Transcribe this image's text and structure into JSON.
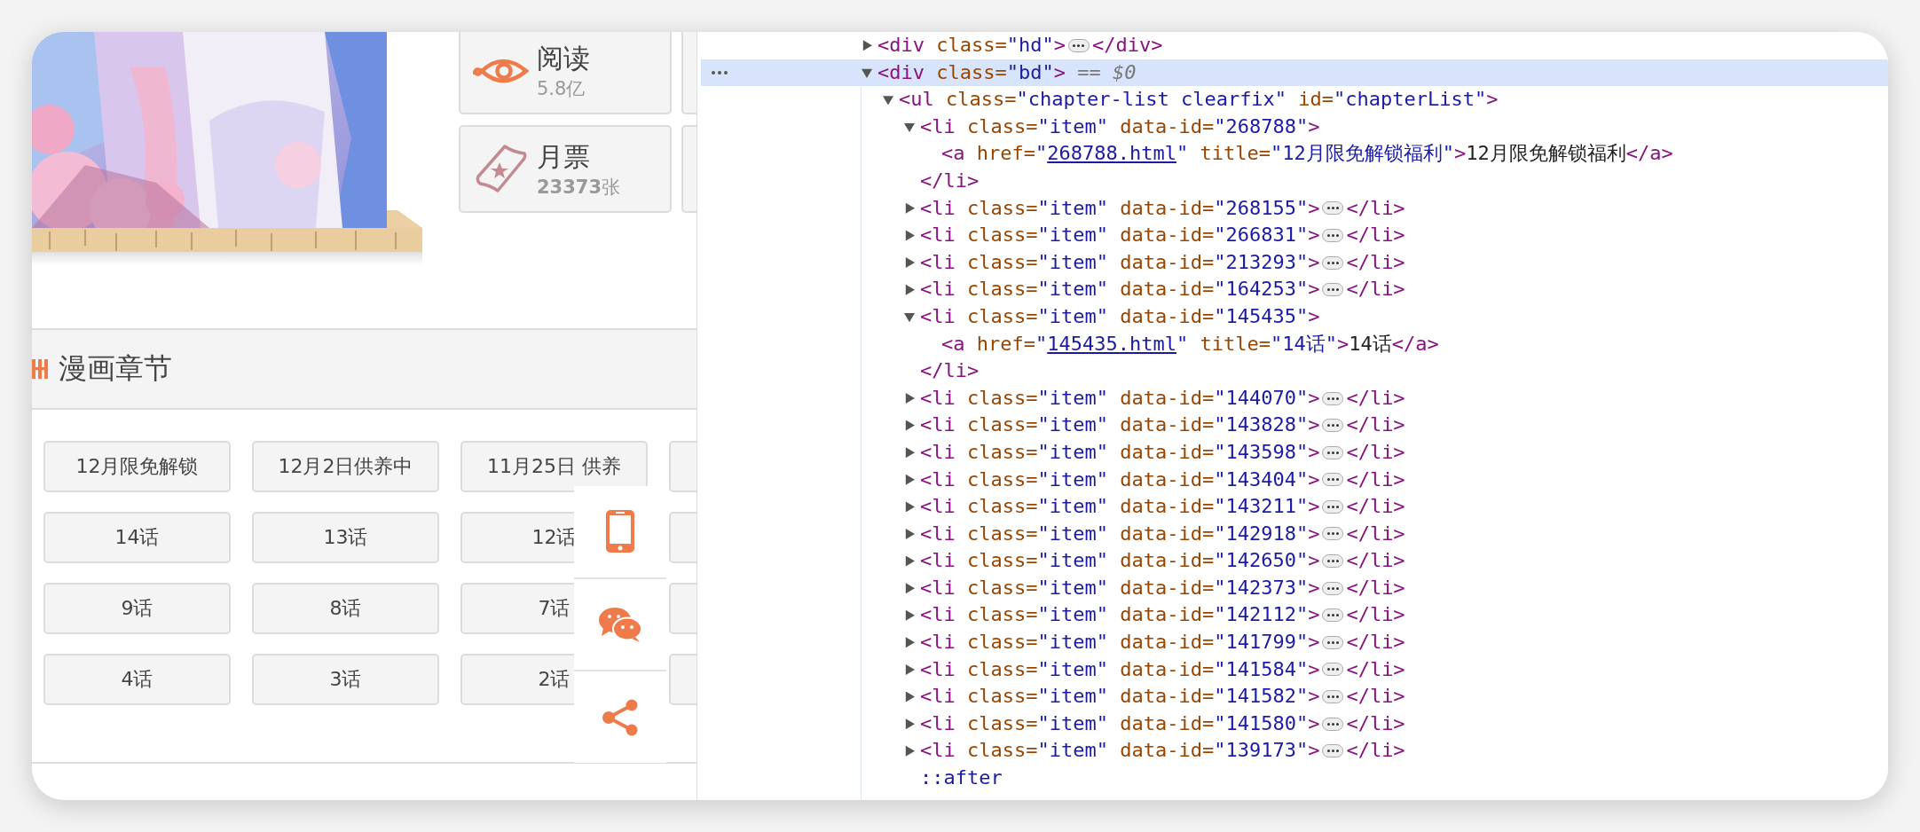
{
  "comic_page": {
    "stats": [
      {
        "kind": "views",
        "label": "阅读",
        "value": "5.8亿"
      },
      {
        "kind": "tickets",
        "label": "月票",
        "value": "**23373**张"
      }
    ],
    "chapters": {
      "title": "漫画章节",
      "items": [
        "12月限免解锁",
        "12月2日供养中",
        "11月25日 供养",
        "14话",
        "13话",
        "12话",
        "9话",
        "8话",
        "7话",
        "4话",
        "3话",
        "2话"
      ]
    }
  },
  "devtools": {
    "elements_tree": [
      {
        "tokens": [
          {
            "kind": "tag",
            "text": "<div"
          },
          {
            "kind": "attr",
            "text": " class="
          },
          {
            "kind": "value",
            "text": "\"hd\""
          },
          {
            "kind": "tag",
            "text": ">"
          }
        ],
        "expanded": false,
        "close": [
          {
            "kind": "tag",
            "text": "</div>"
          }
        ],
        "selected": false
      },
      {
        "tokens": [
          {
            "kind": "tag",
            "text": "<div"
          },
          {
            "kind": "attr",
            "text": " class="
          },
          {
            "kind": "value",
            "text": "\"bd\""
          },
          {
            "kind": "tag",
            "text": ">"
          },
          {
            "kind": "note",
            "text": " == $0"
          }
        ],
        "expanded": true,
        "selected": true,
        "children": [
          {
            "tokens": [
              {
                "kind": "tag",
                "text": "<ul"
              },
              {
                "kind": "attr",
                "text": " class="
              },
              {
                "kind": "value",
                "text": "\"chapter-list clearfix\""
              },
              {
                "kind": "attr",
                "text": " id="
              },
              {
                "kind": "value",
                "text": "\"chapterList\""
              },
              {
                "kind": "tag",
                "text": ">"
              }
            ],
            "expanded": true,
            "selected": false,
            "children": [
              {
                "tokens": [
                  {
                    "kind": "tag",
                    "text": "<li"
                  },
                  {
                    "kind": "attr",
                    "text": " class="
                  },
                  {
                    "kind": "value",
                    "text": "\"item\""
                  },
                  {
                    "kind": "attr",
                    "text": " data-id="
                  },
                  {
                    "kind": "value",
                    "text": "\"268788\""
                  },
                  {
                    "kind": "tag",
                    "text": ">"
                  }
                ],
                "expanded": true,
                "selected": false,
                "close": [
                  {
                    "kind": "tag",
                    "text": "</li>"
                  }
                ],
                "children": [
                  {
                    "tokens": [
                      {
                        "kind": "tag",
                        "text": "<a"
                      },
                      {
                        "kind": "attr",
                        "text": " href="
                      },
                      {
                        "kind": "value",
                        "text": "\""
                      },
                      {
                        "kind": "link",
                        "text": "268788.html"
                      },
                      {
                        "kind": "value",
                        "text": "\""
                      },
                      {
                        "kind": "attr",
                        "text": " title="
                      },
                      {
                        "kind": "value",
                        "text": "\"12月限免解锁福利\""
                      },
                      {
                        "kind": "tag",
                        "text": ">"
                      },
                      {
                        "kind": "text",
                        "text": "12月限免解锁福利"
                      },
                      {
                        "kind": "tag",
                        "text": "</a>"
                      }
                    ],
                    "selected": false
                  }
                ]
              },
              {
                "tokens": [
                  {
                    "kind": "tag",
                    "text": "<li"
                  },
                  {
                    "kind": "attr",
                    "text": " class="
                  },
                  {
                    "kind": "value",
                    "text": "\"item\""
                  },
                  {
                    "kind": "attr",
                    "text": " data-id="
                  },
                  {
                    "kind": "value",
                    "text": "\"268155\""
                  },
                  {
                    "kind": "tag",
                    "text": ">"
                  }
                ],
                "expanded": false,
                "close": [
                  {
                    "kind": "tag",
                    "text": "</li>"
                  }
                ],
                "selected": false
              },
              {
                "tokens": [
                  {
                    "kind": "tag",
                    "text": "<li"
                  },
                  {
                    "kind": "attr",
                    "text": " class="
                  },
                  {
                    "kind": "value",
                    "text": "\"item\""
                  },
                  {
                    "kind": "attr",
                    "text": " data-id="
                  },
                  {
                    "kind": "value",
                    "text": "\"266831\""
                  },
                  {
                    "kind": "tag",
                    "text": ">"
                  }
                ],
                "expanded": false,
                "close": [
                  {
                    "kind": "tag",
                    "text": "</li>"
                  }
                ],
                "selected": false
              },
              {
                "tokens": [
                  {
                    "kind": "tag",
                    "text": "<li"
                  },
                  {
                    "kind": "attr",
                    "text": " class="
                  },
                  {
                    "kind": "value",
                    "text": "\"item\""
                  },
                  {
                    "kind": "attr",
                    "text": " data-id="
                  },
                  {
                    "kind": "value",
                    "text": "\"213293\""
                  },
                  {
                    "kind": "tag",
                    "text": ">"
                  }
                ],
                "expanded": false,
                "close": [
                  {
                    "kind": "tag",
                    "text": "</li>"
                  }
                ],
                "selected": false
              },
              {
                "tokens": [
                  {
                    "kind": "tag",
                    "text": "<li"
                  },
                  {
                    "kind": "attr",
                    "text": " class="
                  },
                  {
                    "kind": "value",
                    "text": "\"item\""
                  },
                  {
                    "kind": "attr",
                    "text": " data-id="
                  },
                  {
                    "kind": "value",
                    "text": "\"164253\""
                  },
                  {
                    "kind": "tag",
                    "text": ">"
                  }
                ],
                "expanded": false,
                "close": [
                  {
                    "kind": "tag",
                    "text": "</li>"
                  }
                ],
                "selected": false
              },
              {
                "tokens": [
                  {
                    "kind": "tag",
                    "text": "<li"
                  },
                  {
                    "kind": "attr",
                    "text": " class="
                  },
                  {
                    "kind": "value",
                    "text": "\"item\""
                  },
                  {
                    "kind": "attr",
                    "text": " data-id="
                  },
                  {
                    "kind": "value",
                    "text": "\"145435\""
                  },
                  {
                    "kind": "tag",
                    "text": ">"
                  }
                ],
                "expanded": true,
                "selected": false,
                "close": [
                  {
                    "kind": "tag",
                    "text": "</li>"
                  }
                ],
                "children": [
                  {
                    "tokens": [
                      {
                        "kind": "tag",
                        "text": "<a"
                      },
                      {
                        "kind": "attr",
                        "text": " href="
                      },
                      {
                        "kind": "value",
                        "text": "\""
                      },
                      {
                        "kind": "link",
                        "text": "145435.html"
                      },
                      {
                        "kind": "value",
                        "text": "\""
                      },
                      {
                        "kind": "attr",
                        "text": " title="
                      },
                      {
                        "kind": "value",
                        "text": "\"14话\""
                      },
                      {
                        "kind": "tag",
                        "text": ">"
                      },
                      {
                        "kind": "text",
                        "text": "14话"
                      },
                      {
                        "kind": "tag",
                        "text": "</a>"
                      }
                    ],
                    "selected": false
                  }
                ]
              },
              {
                "tokens": [
                  {
                    "kind": "tag",
                    "text": "<li"
                  },
                  {
                    "kind": "attr",
                    "text": " class="
                  },
                  {
                    "kind": "value",
                    "text": "\"item\""
                  },
                  {
                    "kind": "attr",
                    "text": " data-id="
                  },
                  {
                    "kind": "value",
                    "text": "\"144070\""
                  },
                  {
                    "kind": "tag",
                    "text": ">"
                  }
                ],
                "expanded": false,
                "close": [
                  {
                    "kind": "tag",
                    "text": "</li>"
                  }
                ],
                "selected": false
              },
              {
                "tokens": [
                  {
                    "kind": "tag",
                    "text": "<li"
                  },
                  {
                    "kind": "attr",
                    "text": " class="
                  },
                  {
                    "kind": "value",
                    "text": "\"item\""
                  },
                  {
                    "kind": "attr",
                    "text": " data-id="
                  },
                  {
                    "kind": "value",
                    "text": "\"143828\""
                  },
                  {
                    "kind": "tag",
                    "text": ">"
                  }
                ],
                "expanded": false,
                "close": [
                  {
                    "kind": "tag",
                    "text": "</li>"
                  }
                ],
                "selected": false
              },
              {
                "tokens": [
                  {
                    "kind": "tag",
                    "text": "<li"
                  },
                  {
                    "kind": "attr",
                    "text": " class="
                  },
                  {
                    "kind": "value",
                    "text": "\"item\""
                  },
                  {
                    "kind": "attr",
                    "text": " data-id="
                  },
                  {
                    "kind": "value",
                    "text": "\"143598\""
                  },
                  {
                    "kind": "tag",
                    "text": ">"
                  }
                ],
                "expanded": false,
                "close": [
                  {
                    "kind": "tag",
                    "text": "</li>"
                  }
                ],
                "selected": false
              },
              {
                "tokens": [
                  {
                    "kind": "tag",
                    "text": "<li"
                  },
                  {
                    "kind": "attr",
                    "text": " class="
                  },
                  {
                    "kind": "value",
                    "text": "\"item\""
                  },
                  {
                    "kind": "attr",
                    "text": " data-id="
                  },
                  {
                    "kind": "value",
                    "text": "\"143404\""
                  },
                  {
                    "kind": "tag",
                    "text": ">"
                  }
                ],
                "expanded": false,
                "close": [
                  {
                    "kind": "tag",
                    "text": "</li>"
                  }
                ],
                "selected": false
              },
              {
                "tokens": [
                  {
                    "kind": "tag",
                    "text": "<li"
                  },
                  {
                    "kind": "attr",
                    "text": " class="
                  },
                  {
                    "kind": "value",
                    "text": "\"item\""
                  },
                  {
                    "kind": "attr",
                    "text": " data-id="
                  },
                  {
                    "kind": "value",
                    "text": "\"143211\""
                  },
                  {
                    "kind": "tag",
                    "text": ">"
                  }
                ],
                "expanded": false,
                "close": [
                  {
                    "kind": "tag",
                    "text": "</li>"
                  }
                ],
                "selected": false
              },
              {
                "tokens": [
                  {
                    "kind": "tag",
                    "text": "<li"
                  },
                  {
                    "kind": "attr",
                    "text": " class="
                  },
                  {
                    "kind": "value",
                    "text": "\"item\""
                  },
                  {
                    "kind": "attr",
                    "text": " data-id="
                  },
                  {
                    "kind": "value",
                    "text": "\"142918\""
                  },
                  {
                    "kind": "tag",
                    "text": ">"
                  }
                ],
                "expanded": false,
                "close": [
                  {
                    "kind": "tag",
                    "text": "</li>"
                  }
                ],
                "selected": false
              },
              {
                "tokens": [
                  {
                    "kind": "tag",
                    "text": "<li"
                  },
                  {
                    "kind": "attr",
                    "text": " class="
                  },
                  {
                    "kind": "value",
                    "text": "\"item\""
                  },
                  {
                    "kind": "attr",
                    "text": " data-id="
                  },
                  {
                    "kind": "value",
                    "text": "\"142650\""
                  },
                  {
                    "kind": "tag",
                    "text": ">"
                  }
                ],
                "expanded": false,
                "close": [
                  {
                    "kind": "tag",
                    "text": "</li>"
                  }
                ],
                "selected": false
              },
              {
                "tokens": [
                  {
                    "kind": "tag",
                    "text": "<li"
                  },
                  {
                    "kind": "attr",
                    "text": " class="
                  },
                  {
                    "kind": "value",
                    "text": "\"item\""
                  },
                  {
                    "kind": "attr",
                    "text": " data-id="
                  },
                  {
                    "kind": "value",
                    "text": "\"142373\""
                  },
                  {
                    "kind": "tag",
                    "text": ">"
                  }
                ],
                "expanded": false,
                "close": [
                  {
                    "kind": "tag",
                    "text": "</li>"
                  }
                ],
                "selected": false
              },
              {
                "tokens": [
                  {
                    "kind": "tag",
                    "text": "<li"
                  },
                  {
                    "kind": "attr",
                    "text": " class="
                  },
                  {
                    "kind": "value",
                    "text": "\"item\""
                  },
                  {
                    "kind": "attr",
                    "text": " data-id="
                  },
                  {
                    "kind": "value",
                    "text": "\"142112\""
                  },
                  {
                    "kind": "tag",
                    "text": ">"
                  }
                ],
                "expanded": false,
                "close": [
                  {
                    "kind": "tag",
                    "text": "</li>"
                  }
                ],
                "selected": false
              },
              {
                "tokens": [
                  {
                    "kind": "tag",
                    "text": "<li"
                  },
                  {
                    "kind": "attr",
                    "text": " class="
                  },
                  {
                    "kind": "value",
                    "text": "\"item\""
                  },
                  {
                    "kind": "attr",
                    "text": " data-id="
                  },
                  {
                    "kind": "value",
                    "text": "\"141799\""
                  },
                  {
                    "kind": "tag",
                    "text": ">"
                  }
                ],
                "expanded": false,
                "close": [
                  {
                    "kind": "tag",
                    "text": "</li>"
                  }
                ],
                "selected": false
              },
              {
                "tokens": [
                  {
                    "kind": "tag",
                    "text": "<li"
                  },
                  {
                    "kind": "attr",
                    "text": " class="
                  },
                  {
                    "kind": "value",
                    "text": "\"item\""
                  },
                  {
                    "kind": "attr",
                    "text": " data-id="
                  },
                  {
                    "kind": "value",
                    "text": "\"141584\""
                  },
                  {
                    "kind": "tag",
                    "text": ">"
                  }
                ],
                "expanded": false,
                "close": [
                  {
                    "kind": "tag",
                    "text": "</li>"
                  }
                ],
                "selected": false
              },
              {
                "tokens": [
                  {
                    "kind": "tag",
                    "text": "<li"
                  },
                  {
                    "kind": "attr",
                    "text": " class="
                  },
                  {
                    "kind": "value",
                    "text": "\"item\""
                  },
                  {
                    "kind": "attr",
                    "text": " data-id="
                  },
                  {
                    "kind": "value",
                    "text": "\"141582\""
                  },
                  {
                    "kind": "tag",
                    "text": ">"
                  }
                ],
                "expanded": false,
                "close": [
                  {
                    "kind": "tag",
                    "text": "</li>"
                  }
                ],
                "selected": false
              },
              {
                "tokens": [
                  {
                    "kind": "tag",
                    "text": "<li"
                  },
                  {
                    "kind": "attr",
                    "text": " class="
                  },
                  {
                    "kind": "value",
                    "text": "\"item\""
                  },
                  {
                    "kind": "attr",
                    "text": " data-id="
                  },
                  {
                    "kind": "value",
                    "text": "\"141580\""
                  },
                  {
                    "kind": "tag",
                    "text": ">"
                  }
                ],
                "expanded": false,
                "close": [
                  {
                    "kind": "tag",
                    "text": "</li>"
                  }
                ],
                "selected": false
              },
              {
                "tokens": [
                  {
                    "kind": "tag",
                    "text": "<li"
                  },
                  {
                    "kind": "attr",
                    "text": " class="
                  },
                  {
                    "kind": "value",
                    "text": "\"item\""
                  },
                  {
                    "kind": "attr",
                    "text": " data-id="
                  },
                  {
                    "kind": "value",
                    "text": "\"139173\""
                  },
                  {
                    "kind": "tag",
                    "text": ">"
                  }
                ],
                "expanded": false,
                "close": [
                  {
                    "kind": "tag",
                    "text": "</li>"
                  }
                ],
                "selected": false
              },
              {
                "tokens": [
                  {
                    "kind": "pseudo",
                    "text": "::after"
                  }
                ],
                "selected": false
              }
            ]
          }
        ]
      }
    ]
  }
}
